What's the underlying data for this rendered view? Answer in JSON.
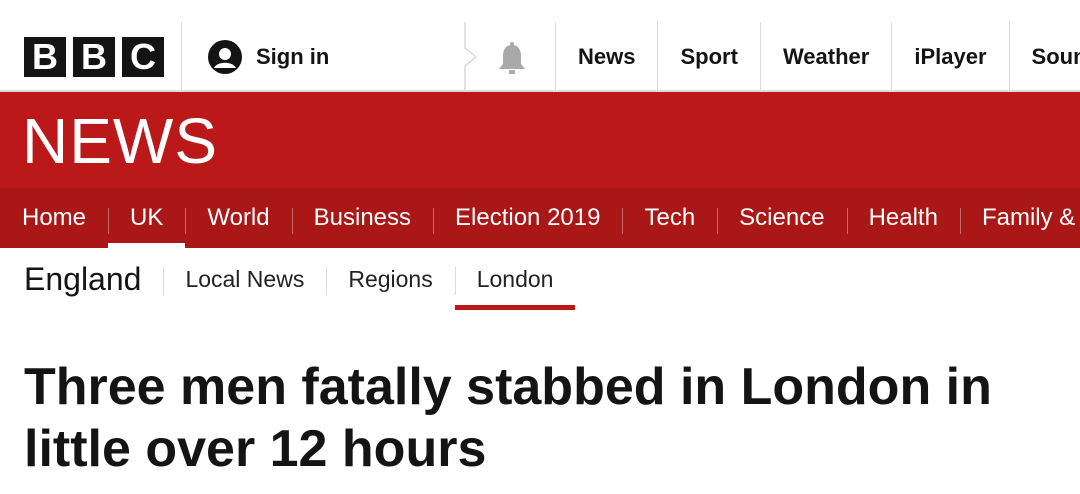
{
  "header": {
    "logo_letters": [
      "B",
      "B",
      "C"
    ],
    "sign_in_label": "Sign in",
    "nav": [
      "News",
      "Sport",
      "Weather",
      "iPlayer",
      "Sounds"
    ]
  },
  "masthead": {
    "brand": "NEWS",
    "color": "#bb1919"
  },
  "main_nav": {
    "items": [
      "Home",
      "UK",
      "World",
      "Business",
      "Election 2019",
      "Tech",
      "Science",
      "Health",
      "Family & Education"
    ],
    "active": "UK"
  },
  "sub_nav": {
    "section_title": "England",
    "items": [
      "Local News",
      "Regions",
      "London"
    ],
    "active": "London"
  },
  "article": {
    "headline": "Three men fatally stabbed in London in little over 12 hours"
  },
  "icons": {
    "signin": "user-icon",
    "notifications": "bell-icon"
  }
}
